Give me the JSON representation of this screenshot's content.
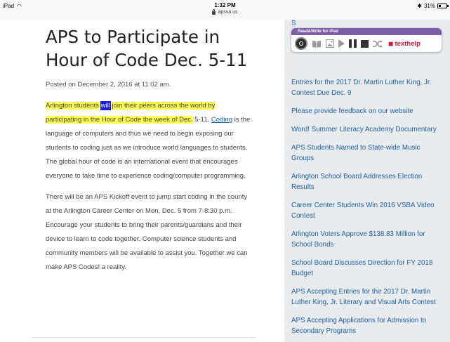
{
  "status_bar": {
    "device": "iPad",
    "time": "1:32 PM",
    "url": "apsva.us",
    "battery": "31%"
  },
  "article": {
    "title": "APS to Participate in Hour of Code Dec. 5-11",
    "posted": "Posted on December 2, 2016 at 11:02 am.",
    "para1": {
      "hl_before": "Arlington students ",
      "hl_word": "will",
      "hl_after": " join their peers across the world by participating in the Hour of Code the week of Dec.",
      "rest1": " 5-11. ",
      "link": "Coding",
      "rest2": " is the language of computers and thus we need to begin exposing our students to coding just as we introduce world languages to students. The global hour of code is an international event that encourages everyone to take time to experience coding/computer programming."
    },
    "para2": "There will be an APS Kickoff event to jump start coding in the county at the Arlington Career Center on Mon, Dec. 5 from 7-8:30 p.m. Encourage your students to bring their parents/guardians and their device to learn to code together.  Computer science students and community members will be available to assist you.  Together we can make APS Codes! a reality."
  },
  "sidebar": {
    "partial_top": "S",
    "partial_second": "S",
    "items": [
      "Entries for the 2017 Dr. Martin Luther King, Jr. Contest Due Dec. 9",
      "Please provide feedback on our website",
      "Word! Summer Literacy Academy Documentary",
      "APS Students Named to State-wide Music Groups",
      "Arlington School Board Addresses Election Results",
      "Career Center Students Win 2016 VSBA Video Contest",
      "Arlington Voters Approve $138.83 Million for School Bonds",
      "School Board Discusses Direction for FY 2018 Budget",
      "APS Accepting Entries for the 2017 Dr. Martin Luther King, Jr. Literary and Visual Arts Contest",
      "APS Accepting Applications for Admission to Secondary Programs"
    ]
  },
  "rw_toolbar": {
    "header": "Read&Write for iPad",
    "brand": "texthelp",
    "colors": {
      "header": "#7b5ea7",
      "brand": "#e0103a",
      "highlight": "#ffff4d",
      "word_highlight": "#1a1ae0"
    }
  }
}
